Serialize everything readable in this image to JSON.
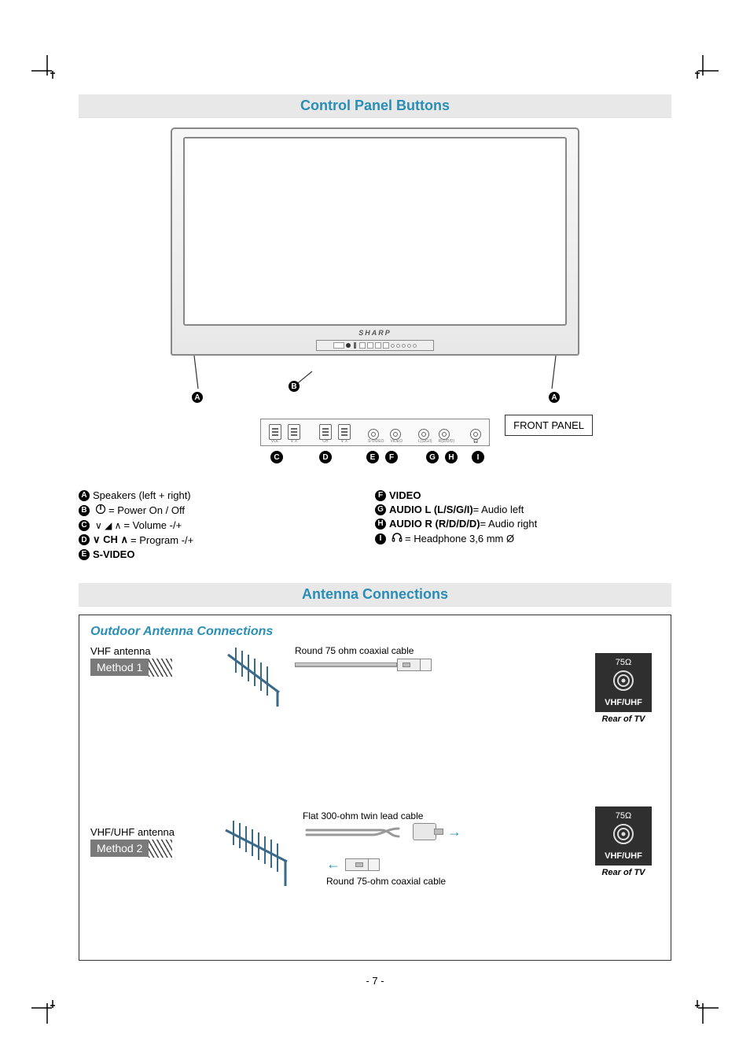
{
  "page_number": "- 7 -",
  "sections": {
    "control_panel": {
      "title": "Control  Panel  Buttons",
      "brand": "SHARP",
      "front_panel_label": "FRONT PANEL",
      "panel_mini_labels": [
        "VOL",
        "CH",
        "S-VIDEO",
        "VIDEO",
        "L(S/G/I)",
        "R(D/D/D)",
        ""
      ],
      "callouts": [
        "A",
        "B",
        "C",
        "D",
        "E",
        "F",
        "G",
        "H",
        "I"
      ],
      "legend_left": [
        {
          "letter": "A",
          "bold": "",
          "text": "Speakers (left + right)"
        },
        {
          "letter": "B",
          "bold": "",
          "symbol": "⏻",
          "text": " = Power On / Off"
        },
        {
          "letter": "C",
          "bold": "",
          "symbol": "∨ ◿ ∧",
          "text": "= Volume -/+"
        },
        {
          "letter": "D",
          "bold": "∨ CH ∧",
          "text": " = Program -/+"
        },
        {
          "letter": "E",
          "bold": "S-VIDEO",
          "text": ""
        }
      ],
      "legend_right": [
        {
          "letter": "F",
          "bold": "VIDEO",
          "text": ""
        },
        {
          "letter": "G",
          "bold": "AUDIO L (L/S/G/I)",
          "text": " = Audio left"
        },
        {
          "letter": "H",
          "bold": "AUDIO R (R/D/D/D)",
          "text": " = Audio right"
        },
        {
          "letter": "I",
          "bold": "",
          "symbol": "🎧",
          "text": " = Headphone 3,6 mm Ø"
        }
      ]
    },
    "antenna": {
      "title": "Antenna  Connections",
      "subtitle": "Outdoor Antenna Connections",
      "method1": {
        "antenna_label": "VHF antenna",
        "method_label": "Method 1",
        "cable_label": "Round 75 ohm coaxial cable"
      },
      "method2": {
        "antenna_label": "VHF/UHF antenna",
        "method_label": "Method 2",
        "cable_top_label": "Flat 300-ohm twin lead cable",
        "cable_bottom_label": "Round 75-ohm coaxial cable"
      },
      "rear_panel": {
        "ohm": "75Ω",
        "vhf_uhf": "VHF/UHF",
        "caption": "Rear of TV"
      }
    }
  }
}
